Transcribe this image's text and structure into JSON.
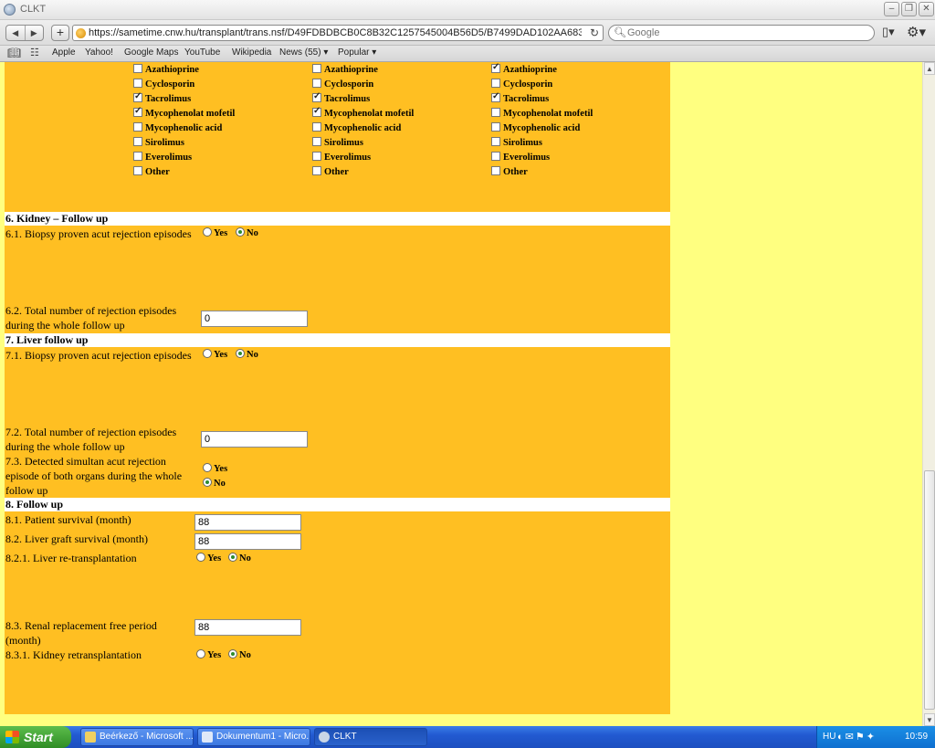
{
  "window": {
    "title": "CLKT",
    "minimize": "–",
    "restore": "❐",
    "close": "✕"
  },
  "toolbar": {
    "back": "◀",
    "forward": "▶",
    "new_tab": "+",
    "url": "https://sametime.cnw.hu/transplant/trans.nsf/D49FDBDBCB0C8B32C1257545004B56D5/B7499DAD102AA683C125754E0(",
    "reload": "↻",
    "search_placeholder": "Google",
    "page_menu": "▯▾",
    "tools_menu": "⚙▾"
  },
  "bookmarks": [
    "Apple",
    "Yahoo!",
    "Google Maps",
    "YouTube",
    "Wikipedia",
    "News (55) ▾",
    "Popular ▾"
  ],
  "drugs": {
    "col1": [
      {
        "label": "Azathioprine",
        "checked": false
      },
      {
        "label": "Cyclosporin",
        "checked": false
      },
      {
        "label": "Tacrolimus",
        "checked": true
      },
      {
        "label": "Mycophenolat mofetil",
        "checked": true
      },
      {
        "label": "Mycophenolic acid",
        "checked": false
      },
      {
        "label": "Sirolimus",
        "checked": false
      },
      {
        "label": "Everolimus",
        "checked": false
      },
      {
        "label": "Other",
        "checked": false
      }
    ],
    "col2": [
      {
        "label": "Azathioprine",
        "checked": false
      },
      {
        "label": "Cyclosporin",
        "checked": false
      },
      {
        "label": "Tacrolimus",
        "checked": true
      },
      {
        "label": "Mycophenolat mofetil",
        "checked": true
      },
      {
        "label": "Mycophenolic acid",
        "checked": false
      },
      {
        "label": "Sirolimus",
        "checked": false
      },
      {
        "label": "Everolimus",
        "checked": false
      },
      {
        "label": "Other",
        "checked": false
      }
    ],
    "col3": [
      {
        "label": "Azathioprine",
        "checked": true
      },
      {
        "label": "Cyclosporin",
        "checked": false
      },
      {
        "label": "Tacrolimus",
        "checked": true
      },
      {
        "label": "Mycophenolat mofetil",
        "checked": false
      },
      {
        "label": "Mycophenolic acid",
        "checked": false
      },
      {
        "label": "Sirolimus",
        "checked": false
      },
      {
        "label": "Everolimus",
        "checked": false
      },
      {
        "label": "Other",
        "checked": false
      }
    ]
  },
  "sections": {
    "s6": "6. Kidney – Follow up",
    "s7": "7. Liver follow up",
    "s8": "8. Follow up"
  },
  "fields": {
    "q61": "6.1. Biopsy proven acut rejection episodes",
    "q62": "6.2. Total number of rejection episodes during the whole follow up",
    "q62_value": "0",
    "q71": "7.1. Biopsy proven acut rejection episodes",
    "q72": "7.2. Total number of rejection episodes during the whole follow up",
    "q72_value": "0",
    "q73": "7.3. Detected simultan acut rejection episode of both organs during the whole follow up",
    "q81": "8.1. Patient survival (month)",
    "q81_value": "88",
    "q82": "8.2. Liver graft survival (month)",
    "q82_value": "88",
    "q821": "8.2.1. Liver re-transplantation",
    "q83": "8.3. Renal replacement free period (month)",
    "q83_value": "88",
    "q831": "8.3.1. Kidney retransplantation",
    "yes": "Yes",
    "no": "No"
  },
  "taskbar": {
    "start": "Start",
    "tasks": [
      "Beérkező - Microsoft ...",
      "Dokumentum1 - Micro...",
      "CLKT"
    ],
    "lang": "HU",
    "clock": "10:59"
  }
}
